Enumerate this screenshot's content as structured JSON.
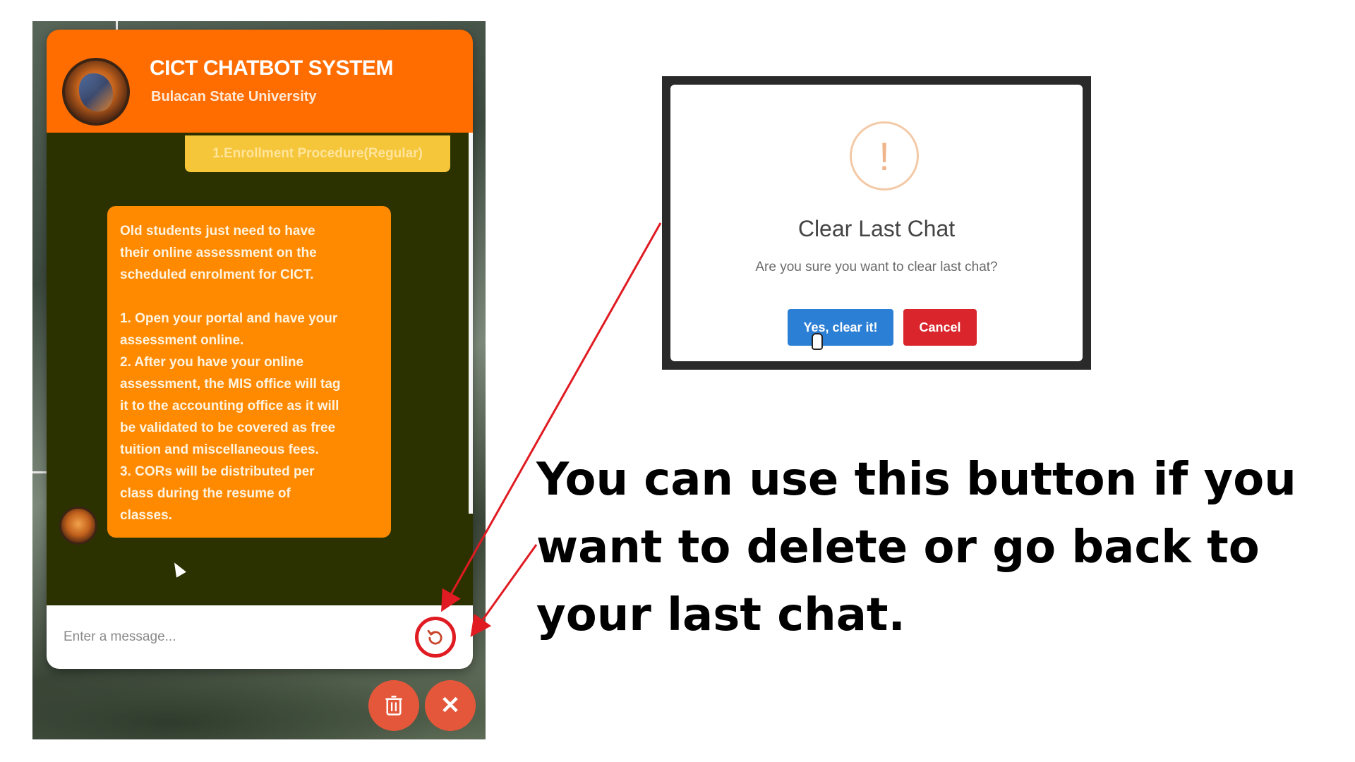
{
  "chatbot": {
    "title": "CICT CHATBOT SYSTEM",
    "subtitle": "Bulacan State University",
    "user_message": "1.Enrollment Procedure(Regular)",
    "bot_message": "Old students just need to have\ntheir online assessment on the\nscheduled enrolment for CICT.\n\n1. Open your portal and have your\nassessment online.\n2. After you have your online\nassessment, the MIS office will tag\nit to the accounting office as it will\nbe validated to be covered as free\ntuition and miscellaneous fees.\n3. CORs will be distributed per\nclass during the resume of\nclasses.",
    "input_placeholder": "Enter a message...",
    "close_symbol": "✕",
    "colors": {
      "header": "#ff6c00",
      "body": "#2b3200",
      "user_bubble": "#f5c53a",
      "bot_bubble": "#ff8a00",
      "fab": "#e4573a",
      "highlight": "#e01b22"
    }
  },
  "dialog": {
    "icon_symbol": "!",
    "title": "Clear Last Chat",
    "text": "Are you sure you want to clear last chat?",
    "confirm_label": "Yes, clear it!",
    "cancel_label": "Cancel",
    "colors": {
      "confirm": "#2b7fd4",
      "cancel": "#d9252b",
      "icon": "#f0b48a"
    }
  },
  "annotation": {
    "caption": "You can use this button if you want to delete or go back to your last chat.",
    "arrow_color": "#e01b22"
  }
}
